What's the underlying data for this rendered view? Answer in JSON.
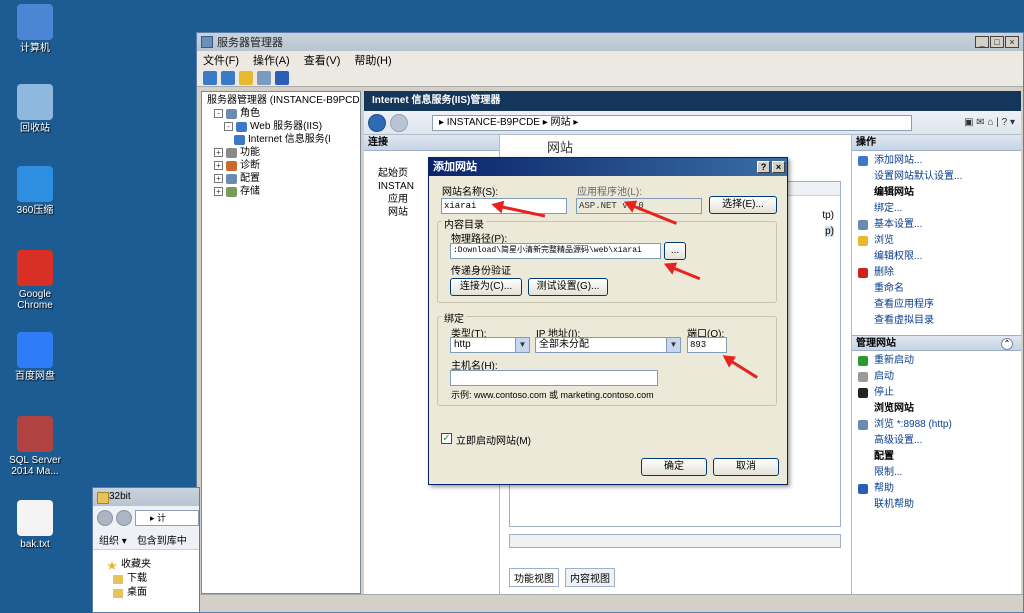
{
  "desktop": {
    "icons": [
      {
        "label": "计算机",
        "name": "computer-icon",
        "color": "#4a86d4"
      },
      {
        "label": "回收站",
        "name": "recycle-bin-icon",
        "color": "#8fb8de"
      },
      {
        "label": "360压缩",
        "name": "zip-360-icon",
        "color": "#2e8fe0"
      },
      {
        "label": "Google Chrome",
        "name": "chrome-icon",
        "color": "#d93025"
      },
      {
        "label": "百度网盘",
        "name": "baidu-netdisk-icon",
        "color": "#2f7df6"
      },
      {
        "label": "SQL Server 2014 Ma...",
        "name": "sql-server-icon",
        "color": "#b04242"
      },
      {
        "label": "bak.txt",
        "name": "text-file-icon",
        "color": "#f4f4f4"
      }
    ]
  },
  "server_manager": {
    "title": "服务器管理器",
    "menu": [
      "文件(F)",
      "操作(A)",
      "查看(V)",
      "帮助(H)"
    ],
    "tree": [
      {
        "label": "服务器管理器 (INSTANCE-B9PCD",
        "indent": 0,
        "exp": ""
      },
      {
        "label": "角色",
        "indent": 1,
        "exp": "-"
      },
      {
        "label": "Web 服务器(IIS)",
        "indent": 2,
        "exp": "-"
      },
      {
        "label": "Internet 信息服务(I",
        "indent": 3,
        "exp": ""
      },
      {
        "label": "功能",
        "indent": 1,
        "exp": "+"
      },
      {
        "label": "诊断",
        "indent": 1,
        "exp": "+"
      },
      {
        "label": "配置",
        "indent": 1,
        "exp": "+"
      },
      {
        "label": "存储",
        "indent": 1,
        "exp": "+"
      }
    ]
  },
  "iis": {
    "title": "Internet 信息服务(IIS)管理器",
    "address": "▸ INSTANCE-B9PCDE ▸ 网站 ▸",
    "connections_label": "连接",
    "conn_tree": [
      "起始页",
      "INSTAN",
      "应用",
      "网站"
    ],
    "center_heading": "网站",
    "row_fragments": [
      "tp)",
      "p)"
    ],
    "tabs": [
      "功能视图",
      "内容视图"
    ],
    "actions_label": "操作",
    "actions": [
      {
        "label": "添加网站...",
        "kind": "item",
        "icon": "add-site-icon",
        "color": "#3a7ac8"
      },
      {
        "label": "设置网站默认设置...",
        "kind": "item"
      },
      {
        "label": "编辑网站",
        "kind": "head"
      },
      {
        "label": "绑定...",
        "kind": "item"
      },
      {
        "label": "基本设置...",
        "kind": "item",
        "icon": "settings-icon",
        "color": "#6a8cb0"
      },
      {
        "label": "浏览",
        "kind": "item",
        "icon": "explore-icon",
        "color": "#e8b830"
      },
      {
        "label": "编辑权限...",
        "kind": "item"
      },
      {
        "label": "删除",
        "kind": "item",
        "icon": "delete-icon",
        "color": "#d02020"
      },
      {
        "label": "重命名",
        "kind": "item"
      },
      {
        "label": "查看应用程序",
        "kind": "item"
      },
      {
        "label": "查看虚拟目录",
        "kind": "item"
      }
    ],
    "manage_label": "管理网站",
    "manage": [
      {
        "label": "重新启动",
        "kind": "item",
        "icon": "restart-icon",
        "color": "#2d9a2d"
      },
      {
        "label": "启动",
        "kind": "item",
        "icon": "start-icon",
        "color": "#9a9a9a"
      },
      {
        "label": "停止",
        "kind": "item",
        "icon": "stop-icon",
        "color": "#222222"
      },
      {
        "label": "浏览网站",
        "kind": "head"
      },
      {
        "label": "浏览 *:8988 (http)",
        "kind": "item",
        "icon": "browse-icon",
        "color": "#6a8cb0"
      },
      {
        "label": "高级设置...",
        "kind": "item"
      },
      {
        "label": "配置",
        "kind": "head"
      },
      {
        "label": "限制...",
        "kind": "item"
      },
      {
        "label": "帮助",
        "kind": "item",
        "icon": "help-icon",
        "color": "#2a5fb8"
      },
      {
        "label": "联机帮助",
        "kind": "item"
      }
    ]
  },
  "explorer": {
    "title": "32bit",
    "address": "▸ 计",
    "toolbar": [
      "组织 ▾",
      "包含到库中"
    ],
    "favorites": [
      "收藏夹",
      "下载",
      "桌面"
    ]
  },
  "dialog": {
    "title": "添加网站",
    "site_name_label": "网站名称(S):",
    "site_name_value": "xiarai",
    "app_pool_label": "应用程序池(L):",
    "app_pool_value": "ASP.NET v4.0",
    "select_button": "选择(E)...",
    "content_dir_label": "内容目录",
    "physical_path_label": "物理路径(P):",
    "physical_path_value": ":Download\\简星小清新完整精品源码\\web\\xiarai",
    "browse_button": "...",
    "passthrough_label": "传递身份验证",
    "connect_as_button": "连接为(C)...",
    "test_settings_button": "测试设置(G)...",
    "binding_label": "绑定",
    "type_label": "类型(T):",
    "type_value": "http",
    "ip_label": "IP 地址(I):",
    "ip_value": "全部未分配",
    "port_label": "端口(O):",
    "port_value": "893",
    "host_label": "主机名(H):",
    "host_value": "",
    "example_text": "示例: www.contoso.com 或 marketing.contoso.com",
    "start_now_label": "立即启动网站(M)",
    "start_now_checked": true,
    "ok_button": "确定",
    "cancel_button": "取消"
  }
}
